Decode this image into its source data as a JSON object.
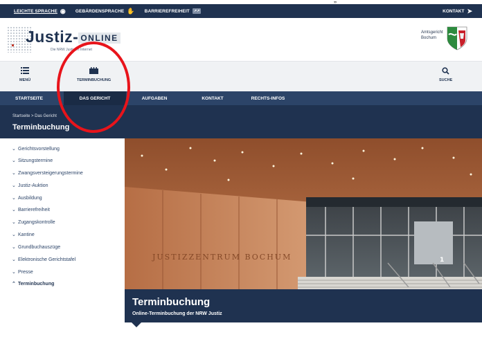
{
  "top_quote": "„",
  "utility_bar": {
    "items": [
      {
        "label": "LEICHTE SPRACHE",
        "icon": "easy-language-icon"
      },
      {
        "label": "GEBÄRDENSPRACHE",
        "icon": "sign-language-icon"
      },
      {
        "label": "BARRIEREFREIHEIT",
        "icon": "external-link-badge"
      }
    ],
    "contact_label": "KONTAKT"
  },
  "header": {
    "logo_text": "Justiz-",
    "logo_online": "ONLINE",
    "logo_tagline": "Die NRW Justiz im Internet",
    "court_line1": "Amtsgericht",
    "court_line2": "Bochum"
  },
  "icon_nav": {
    "menu_label": "MENÜ",
    "booking_label": "TERMINBUCHUNG",
    "search_label": "SUCHE"
  },
  "main_nav": {
    "items": [
      "STARTSEITE",
      "DAS GERICHT",
      "AUFGABEN",
      "KONTAKT",
      "RECHTS-INFOS"
    ],
    "active": "DAS GERICHT"
  },
  "page_heading": {
    "breadcrumb": "Startseite  >  Das Gericht",
    "title": "Terminbuchung"
  },
  "sidebar": {
    "items": [
      "Gerichtsvorstellung",
      "Sitzungstermine",
      "Zwangsversteigerungstermine",
      "Justiz-Auktion",
      "Ausbildung",
      "Barrierefreiheit",
      "Zugangskontrolle",
      "Kantine",
      "Grundbuchauszüge",
      "Elektronische Gerichtstafel",
      "Presse",
      "Terminbuchung"
    ],
    "active": "Terminbuchung"
  },
  "hero": {
    "facade_text": "JUSTIZZENTRUM BOCHUM",
    "door_number": "1"
  },
  "caption": {
    "title": "Terminbuchung",
    "subtitle": "Online-Terminbuchung der NRW Justiz"
  },
  "colors": {
    "navy": "#1f3250",
    "nav_blue": "#2c4468",
    "annotation_red": "#e8141b"
  }
}
